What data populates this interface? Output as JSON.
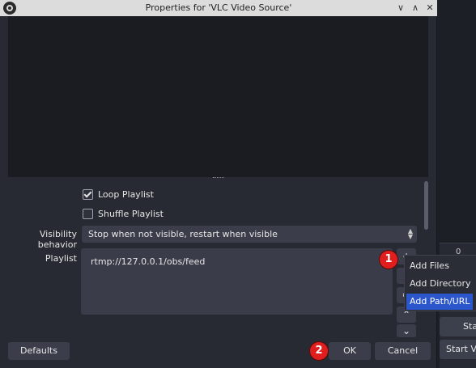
{
  "window": {
    "title": "Properties for 'VLC Video Source'",
    "controls": {
      "collapse": "∨",
      "expand": "∧",
      "close": "✕"
    }
  },
  "properties": {
    "loop_playlist": {
      "label": "Loop Playlist",
      "checked": true
    },
    "shuffle_playlist": {
      "label": "Shuffle Playlist",
      "checked": false
    },
    "visibility_behavior": {
      "label": "Visibility behavior",
      "value": "Stop when not visible, restart when visible"
    },
    "playlist": {
      "label": "Playlist",
      "items": [
        "rtmp://127.0.0.1/obs/feed"
      ]
    }
  },
  "add_menu": {
    "items": [
      "Add Files",
      "Add Directory",
      "Add Path/URL"
    ],
    "selected": "Add Path/URL"
  },
  "callouts": [
    "1",
    "2"
  ],
  "footer": {
    "defaults": "Defaults",
    "ok": "OK",
    "cancel": "Cancel"
  },
  "background_app": {
    "meter_value": "0",
    "button_1": "Sta",
    "button_2": "Start Virt"
  },
  "colors": {
    "accent": "#2b56cc",
    "callout": "#e01e1e",
    "panel": "#272a33"
  }
}
